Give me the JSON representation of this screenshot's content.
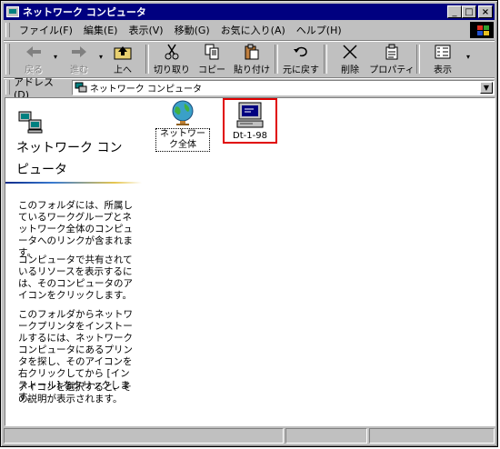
{
  "window": {
    "title": "ネットワーク コンピュータ",
    "controls": {
      "minimize": "_",
      "maximize": "□",
      "close": "×"
    }
  },
  "menu": [
    "ファイル(F)",
    "編集(E)",
    "表示(V)",
    "移動(G)",
    "お気に入り(A)",
    "ヘルプ(H)"
  ],
  "toolbar": {
    "back": "戻る",
    "forward": "進む",
    "up": "上へ",
    "cut": "切り取り",
    "copy": "コピー",
    "paste": "貼り付け",
    "undo": "元に戻す",
    "delete": "削除",
    "properties": "プロパティ",
    "views": "表示"
  },
  "address": {
    "label": "アドレス(D)",
    "value": "ネットワーク コンピュータ"
  },
  "left_panel": {
    "title": "ネットワーク コンピュータ",
    "paragraphs": [
      "このフォルダには、所属しているワークグループとネットワーク全体のコンピュータへのリンクが含まれます。",
      "コンピュータで共有されているリソースを表示するには、そのコンピュータのアイコンをクリックします。",
      "このフォルダからネットワークプリンタをインストールするには、ネットワーク コンピュータにあるプリンタを探し、そのアイコンを右クリックしてから [インストール] をクリックします。",
      "アイコンを選択すると、その説明が表示されます。"
    ]
  },
  "items": {
    "entire_network": "ネットワーク全体",
    "computer": "Dt-1-98"
  }
}
